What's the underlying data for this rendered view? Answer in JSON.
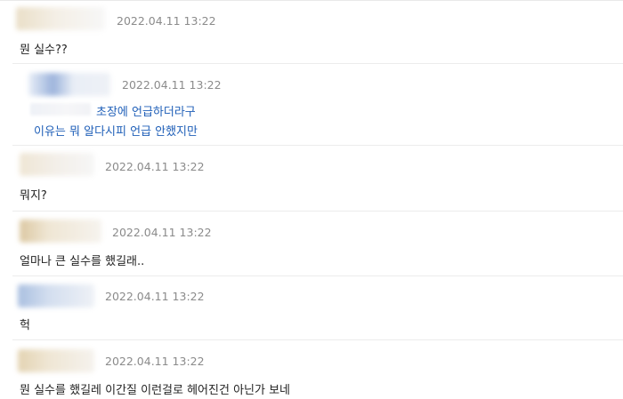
{
  "comments": [
    {
      "timestamp": "2022.04.11 13:22",
      "text": "뭔 실수??",
      "avatar_colors": [
        "#eadfc8",
        "#f4efe6",
        "#f7f7f7"
      ]
    },
    {
      "timestamp": "2022.04.11 13:22",
      "is_reply": true,
      "reply_lines": [
        "초장에 언급하더라구",
        "이유는 뭐 알다시피 언급 안했지만"
      ],
      "avatar_colors": [
        "#e8eef7",
        "#9db4dc",
        "#eef1f6"
      ]
    },
    {
      "timestamp": "2022.04.11 13:22",
      "text": "뭐지?",
      "avatar_colors": [
        "#efe6d5",
        "#f3efe9",
        "#f6f6f6"
      ]
    },
    {
      "timestamp": "2022.04.11 13:22",
      "text": "얼마나 큰 실수를 했길래..",
      "avatar_colors": [
        "#dcc8a2",
        "#efe6d4",
        "#f6f3ee"
      ]
    },
    {
      "timestamp": "2022.04.11 13:22",
      "text": "헉",
      "avatar_colors": [
        "#a9bfe0",
        "#d3deef",
        "#eef1f6"
      ]
    },
    {
      "timestamp": "2022.04.11 13:22",
      "text": "뭔 실수를 했길레 이간질 이런걸로 헤어진건 아닌가 보네",
      "avatar_colors": [
        "#e3d3b2",
        "#efe6d4",
        "#f5f2ed"
      ]
    }
  ]
}
